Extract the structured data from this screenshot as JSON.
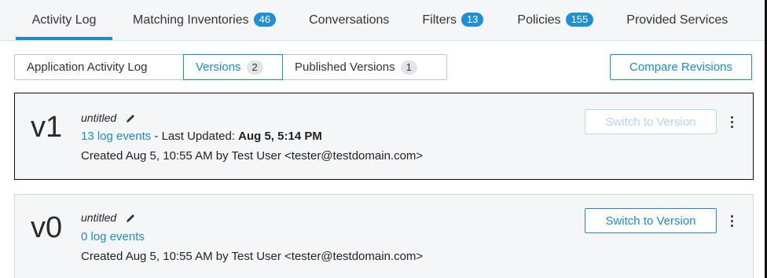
{
  "tabs": [
    {
      "label": "Activity Log",
      "count": null
    },
    {
      "label": "Matching Inventories",
      "count": "46"
    },
    {
      "label": "Conversations",
      "count": null
    },
    {
      "label": "Filters",
      "count": "13"
    },
    {
      "label": "Policies",
      "count": "155"
    },
    {
      "label": "Provided Services",
      "count": null
    }
  ],
  "subtabs": [
    {
      "label": "Application Activity Log",
      "count": null
    },
    {
      "label": "Versions",
      "count": "2"
    },
    {
      "label": "Published Versions",
      "count": "1"
    }
  ],
  "compare_label": "Compare Revisions",
  "versions": [
    {
      "version": "v1",
      "name": "untitled",
      "log_events": "13 log events",
      "updated_prefix": " - Last Updated: ",
      "updated_value": "Aug 5, 5:14 PM",
      "created": "Created Aug 5, 10:55 AM by Test User <tester@testdomain.com>",
      "switch_label": "Switch to Version"
    },
    {
      "version": "v0",
      "name": "untitled",
      "log_events": "0 log events",
      "created": "Created Aug 5, 10:55 AM by Test User <tester@testdomain.com>",
      "switch_label": "Switch to Version"
    }
  ],
  "colors": {
    "accent": "#1a8dd2",
    "badge": "#1f8fd6"
  }
}
